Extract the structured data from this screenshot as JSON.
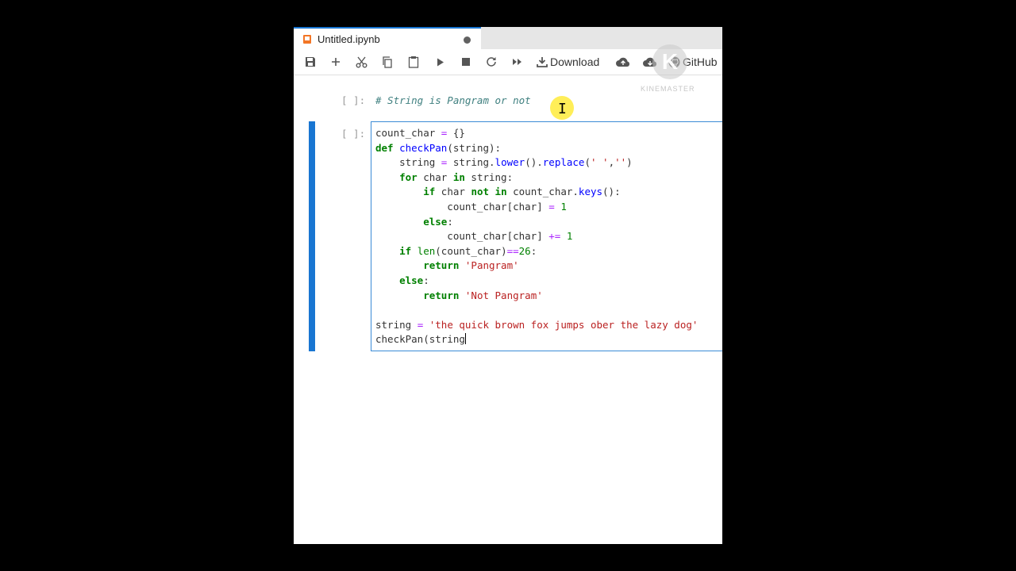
{
  "tab": {
    "title": "Untitled.ipynb"
  },
  "toolbar": {
    "download_label": "Download",
    "github_label": "GitHub"
  },
  "watermark": {
    "text": "KINEMASTER"
  },
  "cells": {
    "markdown": {
      "prompt": "[ ]:",
      "text": "# String is Pangram or not"
    },
    "code": {
      "prompt": "[ ]:",
      "lines": [
        "count_char = {}",
        "def checkPan(string):",
        "    string = string.lower().replace(' ','')",
        "    for char in string:",
        "        if char not in count_char.keys():",
        "            count_char[char] = 1",
        "        else:",
        "            count_char[char] += 1",
        "    if len(count_char)==26:",
        "        return 'Pangram'",
        "    else:",
        "        return 'Not Pangram'",
        "",
        "string = 'the quick brown fox jumps ober the lazy dog'",
        "checkPan(string"
      ]
    }
  },
  "colors": {
    "accent": "#1976d2",
    "keyword": "#008000",
    "string": "#ba2121",
    "comment": "#408080"
  }
}
